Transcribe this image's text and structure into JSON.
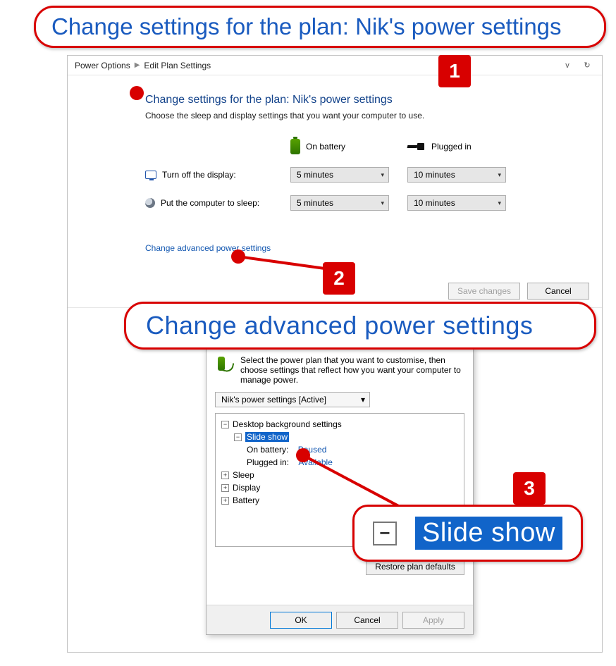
{
  "callouts": {
    "one": "Change settings for the plan: Nik's power settings",
    "two": "Change advanced power settings",
    "three_label": "Slide show",
    "num1": "1",
    "num2": "2",
    "num3": "3"
  },
  "breadcrumb": {
    "a": "Power Options",
    "b": "Edit Plan Settings"
  },
  "plan": {
    "title": "Change settings for the plan: Nik's power settings",
    "subtitle": "Choose the sleep and display settings that you want your computer to use.",
    "col_battery": "On battery",
    "col_plugged": "Plugged in",
    "row_display": "Turn off the display:",
    "row_sleep": "Put the computer to sleep:",
    "val_display_batt": "5 minutes",
    "val_display_plug": "10 minutes",
    "val_sleep_batt": "5 minutes",
    "val_sleep_plug": "10 minutes",
    "link_advanced": "Change advanced power settings",
    "btn_save": "Save changes",
    "btn_cancel": "Cancel"
  },
  "dialog": {
    "desc": "Select the power plan that you want to customise, then choose settings that reflect how you want your computer to manage power.",
    "combo": "Nik's power settings [Active]",
    "tree": {
      "root": "Desktop background settings",
      "slide": "Slide show",
      "onbatt_label": "On battery:",
      "onbatt_val": "Paused",
      "plugged_label": "Plugged in:",
      "plugged_val": "Available",
      "sleep": "Sleep",
      "display": "Display",
      "battery": "Battery"
    },
    "restore": "Restore plan defaults",
    "ok": "OK",
    "cancel": "Cancel",
    "apply": "Apply"
  }
}
